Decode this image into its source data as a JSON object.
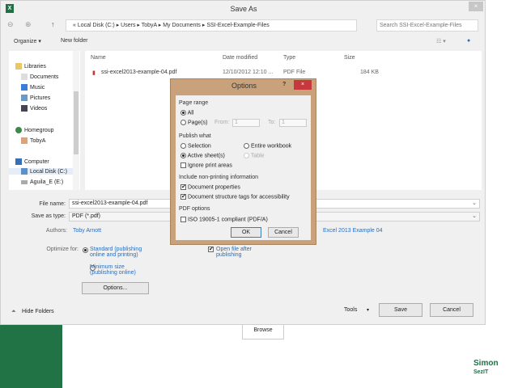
{
  "window": {
    "title": "Save As",
    "close": "×"
  },
  "address": {
    "prefix": "«",
    "path": [
      "Local Disk (C:)",
      "Users",
      "TobyA",
      "My Documents",
      "SSI-Excel-Example-Files"
    ],
    "search_placeholder": "Search SSI-Excel-Example-Files"
  },
  "toolbar": {
    "organize": "Organize ▾",
    "new_folder": "New folder"
  },
  "sidebar": {
    "items": [
      "Libraries",
      "Documents",
      "Music",
      "Pictures",
      "Videos",
      "Homegroup",
      "TobyA",
      "Computer",
      "Local Disk (C:)",
      "Aguila_E (E:)"
    ]
  },
  "files": {
    "columns": [
      "Name",
      "Date modified",
      "Type",
      "Size"
    ],
    "rows": [
      {
        "name": "ssi-excel2013-example-04.pdf",
        "date": "12/10/2012 12:10 ...",
        "type": "PDF File",
        "size": "184 KB"
      }
    ]
  },
  "form": {
    "file_name_label": "File name:",
    "file_name": "ssi-excel2013-example-04.pdf",
    "save_type_label": "Save as type:",
    "save_type": "PDF (*.pdf)",
    "authors_label": "Authors:",
    "authors": "Toby Arnott",
    "title": "Excel 2013 Example 04",
    "optimize_label": "Optimize for:",
    "opt_standard": "Standard (publishing online and printing)",
    "opt_minimum": "Minimum size (publishing online)",
    "open_after": "Open file after publishing",
    "options_btn": "Options...",
    "hide_folders": "Hide Folders",
    "tools": "Tools",
    "save": "Save",
    "cancel": "Cancel"
  },
  "options": {
    "title": "Options",
    "help": "?",
    "close": "×",
    "page_range": "Page range",
    "all": "All",
    "pages": "Page(s)",
    "from": "From:",
    "from_val": "1",
    "to": "To:",
    "to_val": "1",
    "publish_what": "Publish what",
    "selection": "Selection",
    "entire_workbook": "Entire workbook",
    "active_sheets": "Active sheet(s)",
    "table": "Table",
    "ignore_print": "Ignore print areas",
    "non_printing": "Include non-printing information",
    "doc_props": "Document properties",
    "doc_tags": "Document structure tags for accessibility",
    "pdf_options": "PDF options",
    "iso": "ISO 19005-1 compliant (PDF/A)",
    "ok": "OK",
    "cancel": "Cancel"
  },
  "background": {
    "browse": "Browse",
    "logo": "Simon SezIT.com"
  }
}
